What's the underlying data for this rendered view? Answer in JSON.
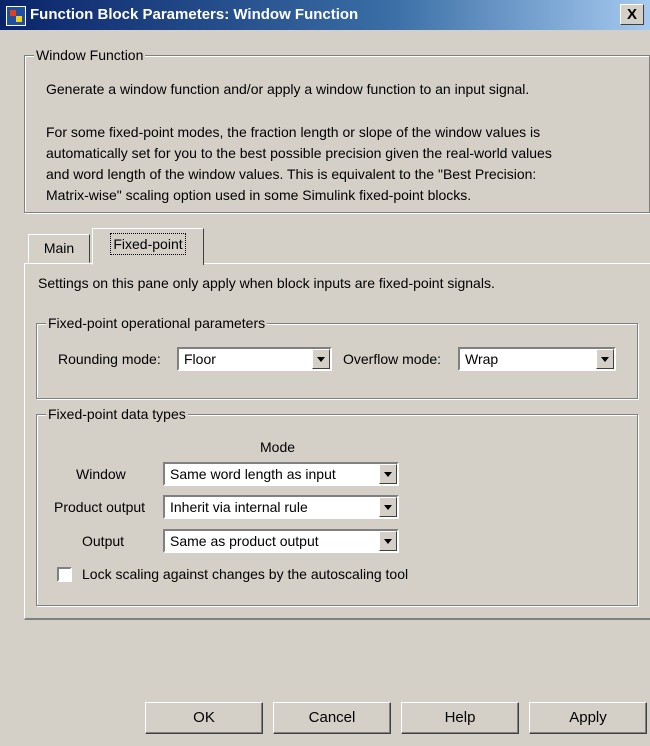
{
  "window": {
    "title": "Function Block Parameters: Window Function",
    "close_glyph": "X"
  },
  "description_group": {
    "legend": "Window Function",
    "line1": "Generate a window function and/or apply a window function to an input signal.",
    "para2": [
      "For some fixed-point modes, the fraction length or slope of the window values is",
      "automatically set for you to the best possible precision given the real-world values",
      "and word length of the window values. This is equivalent to the \"Best Precision:",
      "Matrix-wise\" scaling option used in some Simulink fixed-point blocks."
    ]
  },
  "tabs": [
    {
      "label": "Main",
      "selected": false
    },
    {
      "label": "Fixed-point",
      "selected": true
    }
  ],
  "fixed_point": {
    "intro": "Settings on this pane only apply when block inputs are fixed-point signals.",
    "operational": {
      "legend": "Fixed-point operational parameters",
      "rounding_label": "Rounding mode:",
      "rounding_value": "Floor",
      "overflow_label": "Overflow mode:",
      "overflow_value": "Wrap"
    },
    "data_types": {
      "legend": "Fixed-point data types",
      "mode_header": "Mode",
      "rows": [
        {
          "label": "Window",
          "value": "Same word length as input"
        },
        {
          "label": "Product output",
          "value": "Inherit via internal rule"
        },
        {
          "label": "Output",
          "value": "Same as product output"
        }
      ],
      "lock_label": "Lock scaling against changes by the autoscaling tool",
      "lock_checked": false
    }
  },
  "buttons": {
    "ok": "OK",
    "cancel": "Cancel",
    "help": "Help",
    "apply": "Apply"
  }
}
